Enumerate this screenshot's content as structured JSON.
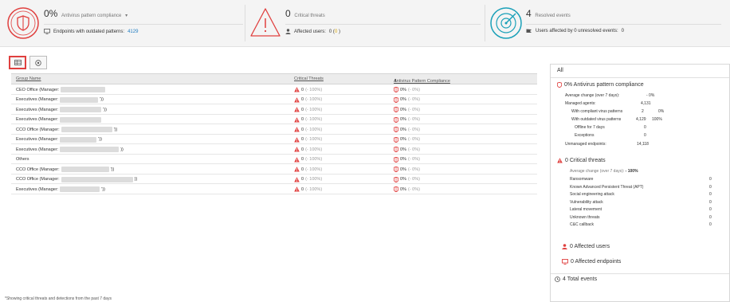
{
  "colors": {
    "red": "#e0403f",
    "teal": "#1aa0b8",
    "link": "#1f7bc1"
  },
  "summary": {
    "compliance": {
      "value": "0%",
      "label": "Antivirus pattern compliance",
      "sub_label": "Endpoints with outdated patterns:",
      "sub_value": "4129",
      "icon": "shield-icon"
    },
    "threats": {
      "value": "0",
      "label": "Critical threats",
      "sub_label": "Affected users:",
      "sub_value_a": "0 (",
      "sub_value_b": "0",
      "sub_value_c": " )",
      "icon": "warning-icon"
    },
    "resolved": {
      "value": "4",
      "label": "Resolved events",
      "sub_label": "Users affected by 0 unresolved events:",
      "sub_value": "0",
      "icon": "radar-icon"
    }
  },
  "table": {
    "headers": [
      "Group Name",
      "Critical Threats",
      "Antivirus Pattern Compliance"
    ],
    "rows": [
      {
        "name": "CEO Office (Manager:",
        "tail": "",
        "threats": "0",
        "tchange": "(- 100%)",
        "compliance": "0%",
        "cchange": "(- 0%)",
        "redact": 56
      },
      {
        "name": "Executives (Manager:",
        "tail": "'))",
        "threats": "0",
        "tchange": "(- 100%)",
        "compliance": "0%",
        "cchange": "(- 0%)",
        "redact": 48
      },
      {
        "name": "Executives (Manager:",
        "tail": "'))",
        "threats": "0",
        "tchange": "(- 100%)",
        "compliance": "0%",
        "cchange": "(- 0%)",
        "redact": 52
      },
      {
        "name": "Executives (Manager:",
        "tail": "",
        "threats": "0",
        "tchange": "(- 100%)",
        "compliance": "0%",
        "cchange": "(- 0%)",
        "redact": 52
      },
      {
        "name": "CCO Office (Manager:",
        "tail": "'))",
        "threats": "0",
        "tchange": "(- 100%)",
        "compliance": "0%",
        "cchange": "(- 0%)",
        "redact": 64
      },
      {
        "name": "Executives (Manager:",
        "tail": "'))",
        "threats": "0",
        "tchange": "(- 100%)",
        "compliance": "0%",
        "cchange": "(- 0%)",
        "redact": 46
      },
      {
        "name": "Executives (Manager:",
        "tail": "))",
        "threats": "0",
        "tchange": "(- 100%)",
        "compliance": "0%",
        "cchange": "(- 0%)",
        "redact": 74
      },
      {
        "name": "Others",
        "tail": "",
        "threats": "0",
        "tchange": "(- 100%)",
        "compliance": "0%",
        "cchange": "(- 0%)",
        "redact": 0
      },
      {
        "name": "CCO Office (Manager:",
        "tail": "'))",
        "threats": "0",
        "tchange": "(- 100%)",
        "compliance": "0%",
        "cchange": "(- 0%)",
        "redact": 60
      },
      {
        "name": "CCO Office (Manager:",
        "tail": "))",
        "threats": "0",
        "tchange": "(- 100%)",
        "compliance": "0%",
        "cchange": "(- 0%)",
        "redact": 90
      },
      {
        "name": "Executives (Manager:",
        "tail": "'))",
        "threats": "0",
        "tchange": "(- 100%)",
        "compliance": "0%",
        "cchange": "(- 0%)",
        "redact": 50
      }
    ]
  },
  "panel": {
    "title": "All",
    "compliance_title": "0%  Antivirus pattern compliance",
    "avg_change_label": "Average change (over 7 days):",
    "avg_change_value": "- 0%",
    "managed_label": "Managed agents:",
    "managed_value": "4,131",
    "compliant_label": "With compliant virus patterns",
    "compliant_value": "2",
    "compliant_pct": "0%",
    "outdated_label": "With outdated virus patterns",
    "outdated_value": "4,129",
    "outdated_pct": "100%",
    "offline_label": "Offline for 7 days",
    "offline_value": "0",
    "exceptions_label": "Exceptions",
    "exceptions_value": "0",
    "unmanaged_label": "Unmanaged endpoints:",
    "unmanaged_value": "14,118",
    "threats_title": "0  Critical threats",
    "threats_avg": "Average change (over 7 days):",
    "threats_avg_value": "- 100%",
    "threat_types": [
      {
        "label": "Ransomware",
        "value": "0"
      },
      {
        "label": "Known Advanced Persistent Threat (APT)",
        "value": "0"
      },
      {
        "label": "Social engineering attack",
        "value": "0"
      },
      {
        "label": "Vulnerability attack",
        "value": "0"
      },
      {
        "label": "Lateral movement",
        "value": "0"
      },
      {
        "label": "Unknown threats",
        "value": "0"
      },
      {
        "label": "C&C callback",
        "value": "0"
      }
    ],
    "affected_users": "0  Affected users",
    "affected_endpoints": "0  Affected endpoints",
    "total_events": "4  Total events"
  },
  "footnote": "*Showing critical threats and detections from the past 7 days"
}
